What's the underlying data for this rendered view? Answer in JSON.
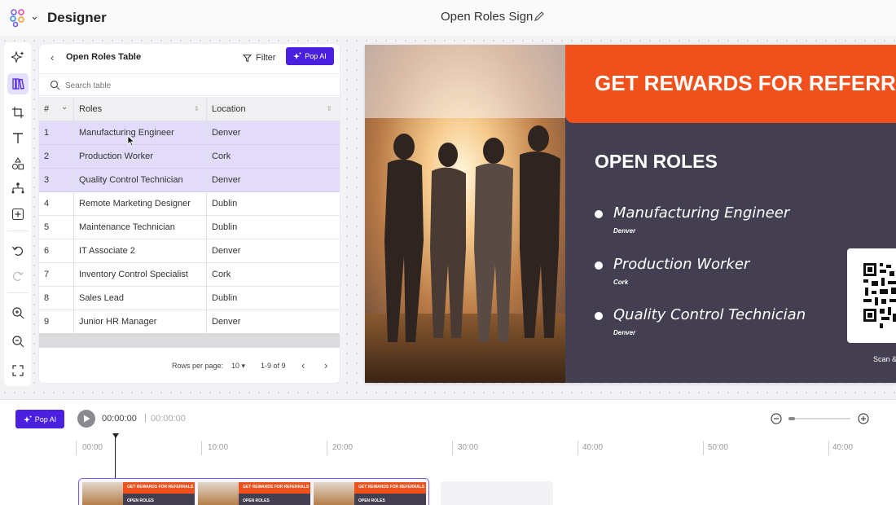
{
  "app": {
    "name": "Designer",
    "document_title": "Open Roles Sign"
  },
  "toolbar": {
    "tools": [
      "ai-sparkle-icon",
      "library-icon",
      "crop-icon",
      "text-icon",
      "shapes-icon",
      "connector-icon",
      "add-icon",
      "undo-icon",
      "redo-icon",
      "zoom-in-icon",
      "zoom-out-icon",
      "fit-screen-icon"
    ],
    "active_tool": "library-icon"
  },
  "table_panel": {
    "title": "Open Roles Table",
    "filter_label": "Filter",
    "popai_label": "Pop AI",
    "search_placeholder": "Search table",
    "columns": {
      "num": "#",
      "roles": "Roles",
      "location": "Location"
    },
    "rows": [
      {
        "num": "1",
        "role": "Manufacturing Engineer",
        "location": "Denver",
        "selected": true
      },
      {
        "num": "2",
        "role": "Production Worker",
        "location": "Cork",
        "selected": true
      },
      {
        "num": "3",
        "role": "Quality Control Technician",
        "location": "Denver",
        "selected": true
      },
      {
        "num": "4",
        "role": "Remote Marketing Designer",
        "location": "Dublin",
        "selected": false
      },
      {
        "num": "5",
        "role": "Maintenance Technician",
        "location": "Dublin",
        "selected": false
      },
      {
        "num": "6",
        "role": "IT Associate 2",
        "location": "Denver",
        "selected": false
      },
      {
        "num": "7",
        "role": "Inventory Control Specialist",
        "location": "Cork",
        "selected": false
      },
      {
        "num": "8",
        "role": "Sales Lead",
        "location": "Dublin",
        "selected": false
      },
      {
        "num": "9",
        "role": "Junior HR Manager",
        "location": "Denver",
        "selected": false
      }
    ],
    "pagination": {
      "rows_per_page_label": "Rows per page:",
      "rows_per_page": "10",
      "range": "1-9 of 9"
    }
  },
  "sign": {
    "banner": "GET REWARDS FOR REFERRAL",
    "heading": "OPEN ROLES",
    "items": [
      {
        "role": "Manufacturing Engineer",
        "location": "Denver"
      },
      {
        "role": "Production Worker",
        "location": "Cork"
      },
      {
        "role": "Quality Control Technician",
        "location": "Denver"
      }
    ],
    "scan_text": "Scan &",
    "colors": {
      "banner": "#f0501c",
      "background": "#443e51"
    }
  },
  "timeline": {
    "popai_label": "Pop AI",
    "current_time": "00:00:00",
    "separator": "|",
    "total_time": "00:00:00",
    "ruler_labels": [
      "00:00",
      "10:00",
      "20:00",
      "30:00",
      "40:00",
      "50:00",
      "40:00"
    ],
    "thumb_banner": "GET REWARDS FOR REFERRALS",
    "thumb_heading": "OPEN ROLES"
  },
  "accent_color": "#4a1fe0"
}
